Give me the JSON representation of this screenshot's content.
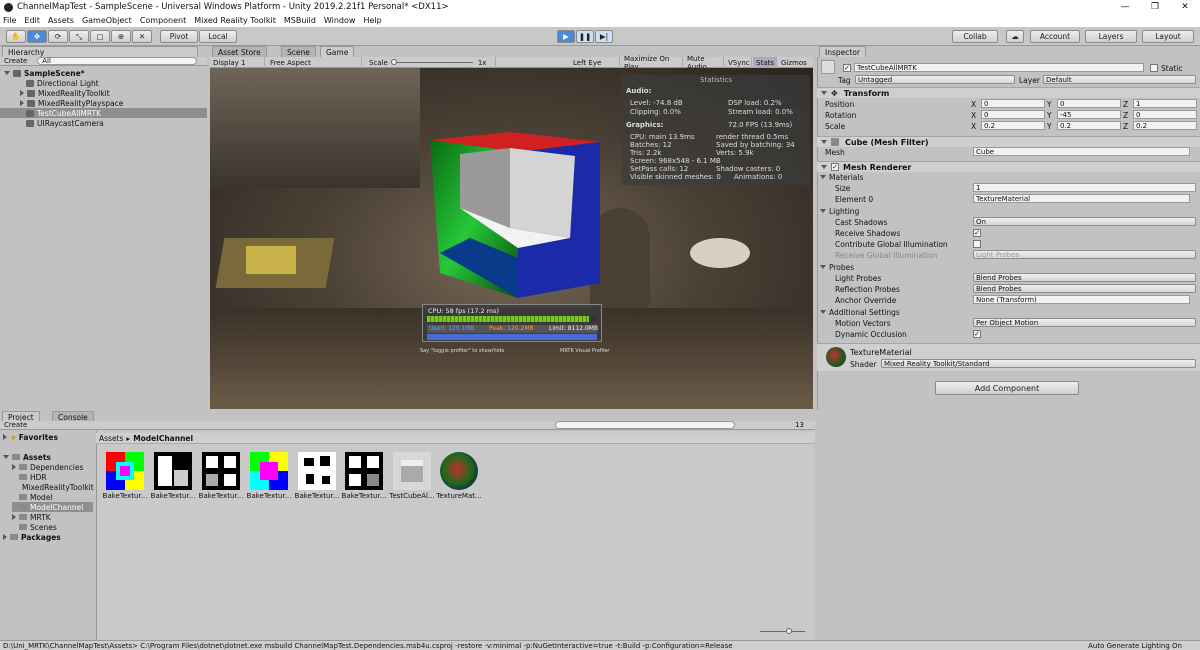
{
  "window": {
    "title": "ChannelMapTest - SampleScene - Universal Windows Platform - Unity 2019.2.21f1 Personal* <DX11>"
  },
  "menu": [
    "File",
    "Edit",
    "Assets",
    "GameObject",
    "Component",
    "Mixed Reality Toolkit",
    "MSBuild",
    "Window",
    "Help"
  ],
  "toolbar": {
    "pivot": "Pivot",
    "local": "Local",
    "collab": "Collab",
    "account": "Account",
    "layers": "Layers",
    "layout": "Layout"
  },
  "tabs": {
    "hierarchy": "Hierarchy",
    "asset_store": "Asset Store",
    "scene": "Scene",
    "game": "Game",
    "inspector": "Inspector",
    "project": "Project",
    "console": "Console"
  },
  "hierarchy": {
    "create": "Create",
    "search": "All",
    "items": [
      {
        "label": "SampleScene*"
      },
      {
        "label": "Directional Light"
      },
      {
        "label": "MixedRealityToolkit"
      },
      {
        "label": "MixedRealityPlayspace"
      },
      {
        "label": "TestCubeAllMRTK"
      },
      {
        "label": "UIRaycastCamera"
      }
    ]
  },
  "game_toolbar": {
    "display": "Display 1",
    "aspect": "Free Aspect",
    "scale_label": "Scale",
    "scale_value": "1x",
    "eye": "Left Eye",
    "max": "Maximize On Play",
    "mute": "Mute Audio",
    "vsync": "VSync",
    "stats": "Stats",
    "gizmos": "Gizmos"
  },
  "stats": {
    "title": "Statistics",
    "audio": "Audio:",
    "level": "Level: -74.8 dB",
    "clipping": "Clipping: 0.0%",
    "dsp": "DSP load: 0.2%",
    "stream": "Stream load: 0.0%",
    "graphics": "Graphics:",
    "fps": "72.0 FPS (13.9ms)",
    "cpu": "CPU: main 13.9ms",
    "render": "render thread 0.5ms",
    "batches": "Batches: 12",
    "saved": "Saved by batching: 34",
    "tris": "Tris: 2.2k",
    "verts": "Verts: 5.9k",
    "screen": "Screen: 968x548 - 6.1 MB",
    "setpass": "SetPass calls: 12",
    "shadow": "Shadow casters: 0",
    "skinned": "Visible skinned meshes: 0",
    "anim": "Animations: 0"
  },
  "profiler": {
    "cpu": "CPU: 58 fps (17.2 ms)",
    "used": "Used: 120.1MB",
    "peak": "Peak: 120.2MB",
    "limit": "Limit: 8112.0MB",
    "hint_left": "Say \"toggle profiler\" to show/hide",
    "hint_right": "MRTK Visual Profiler",
    "fps_fill": 0.95
  },
  "inspector": {
    "object_name": "TestCubeAllMRTK",
    "static": "Static",
    "tag_label": "Tag",
    "tag": "Untagged",
    "layer_label": "Layer",
    "layer": "Default",
    "transform": {
      "title": "Transform",
      "position": "Position",
      "rotation": "Rotation",
      "scale": "Scale",
      "pos": [
        "0",
        "0",
        "1"
      ],
      "rot": [
        "0",
        "-45",
        "0"
      ],
      "scl": [
        "0.2",
        "0.2",
        "0.2"
      ]
    },
    "mesh_filter": {
      "title": "Cube (Mesh Filter)",
      "mesh_label": "Mesh",
      "mesh": "Cube"
    },
    "mesh_renderer": {
      "title": "Mesh Renderer",
      "materials": "Materials",
      "size_label": "Size",
      "size": "1",
      "element0_label": "Element 0",
      "element0": "TextureMaterial",
      "lighting": "Lighting",
      "cast_label": "Cast Shadows",
      "cast": "On",
      "receive_label": "Receive Shadows",
      "contrib_label": "Contribute Global Illumination",
      "rgi_label": "Receive Global Illumination",
      "rgi": "Light Probes",
      "probes": "Probes",
      "lp_label": "Light Probes",
      "lp": "Blend Probes",
      "rp_label": "Reflection Probes",
      "rp": "Blend Probes",
      "anchor_label": "Anchor Override",
      "anchor": "None (Transform)",
      "additional": "Additional Settings",
      "mv_label": "Motion Vectors",
      "mv": "Per Object Motion",
      "occ_label": "Dynamic Occlusion"
    },
    "material": {
      "name": "TextureMaterial",
      "shader_label": "Shader",
      "shader": "Mixed Reality Toolkit/Standard"
    },
    "add_component": "Add Component",
    "xyz": [
      "X",
      "Y",
      "Z"
    ]
  },
  "project": {
    "create": "Create",
    "count": "13",
    "breadcrumb_root": "Assets",
    "breadcrumb_leaf": "ModelChannel",
    "tree": [
      {
        "label": "Favorites",
        "bold": true
      },
      {
        "label": "Assets",
        "bold": true
      },
      {
        "label": "Dependencies"
      },
      {
        "label": "HDR"
      },
      {
        "label": "MixedRealityToolkit"
      },
      {
        "label": "Model"
      },
      {
        "label": "ModelChannel"
      },
      {
        "label": "MRTK"
      },
      {
        "label": "Scenes"
      },
      {
        "label": "Packages",
        "bold": true
      }
    ],
    "assets": [
      "BakeTextur...",
      "BakeTextur...",
      "BakeTextur...",
      "BakeTextur...",
      "BakeTextur...",
      "BakeTextur...",
      "TestCubeAl...",
      "TextureMat..."
    ]
  },
  "status": {
    "left": "D:\\Uni_MRTK\\ChannelMapTest\\Assets> C:\\Program Files\\dotnet\\dotnet.exe msbuild ChannelMapTest.Dependencies.msb4u.csproj -restore  -v:minimal -p:NuGetInteractive=true  -t:Build -p:Configuration=Release",
    "right": "Auto Generate Lighting On"
  }
}
